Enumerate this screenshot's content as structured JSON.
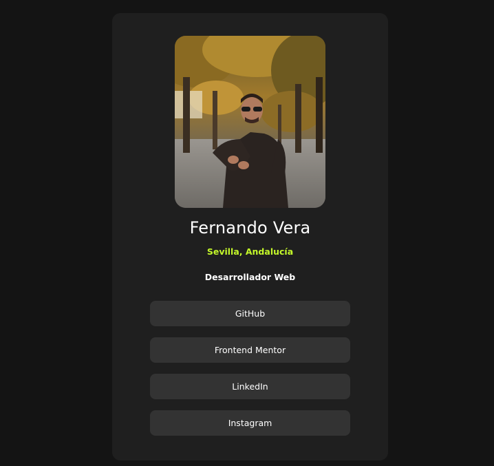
{
  "profile": {
    "name": "Fernando Vera",
    "location": "Sevilla, Andalucía",
    "bio": "Desarrollador Web"
  },
  "links": [
    {
      "label": "GitHub"
    },
    {
      "label": "Frontend Mentor"
    },
    {
      "label": "LinkedIn"
    },
    {
      "label": "Instagram"
    }
  ],
  "colors": {
    "page_background": "#141414",
    "card_background": "#1f1f1f",
    "button_background": "#333333",
    "accent": "#c4f82a",
    "text": "#ffffff"
  }
}
